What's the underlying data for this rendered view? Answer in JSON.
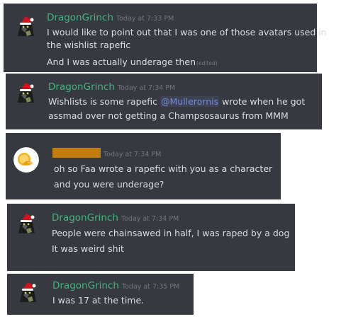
{
  "messages": [
    {
      "author": "DragonGrinch",
      "timestamp": "Today at 7:33 PM",
      "lines": [
        "I would like to point out that I was one of those avatars used in",
        "the wishlist rapefic"
      ],
      "followup": {
        "text": "And I was actually underage then",
        "edited": "(edited)"
      }
    },
    {
      "author": "DragonGrinch",
      "timestamp": "Today at 7:34 PM",
      "line1_before": "Wishlists is some rapefic ",
      "mention": "@Mullerornis",
      "line1_after": " wrote when he got",
      "line2": "assmad over not getting a Champsosaurus from MMM"
    },
    {
      "author_redacted": true,
      "timestamp": "Today at 7:34 PM",
      "lines": [
        "oh so Faa wrote a rapefic with you as a character",
        "and you were underage?"
      ]
    },
    {
      "author": "DragonGrinch",
      "timestamp": "Today at 7:34 PM",
      "lines": [
        "People were chainsawed in half, I was raped by a dog",
        "It was weird shit"
      ]
    },
    {
      "author": "DragonGrinch",
      "timestamp": "Today at 7:35 PM",
      "lines": [
        "I was 17 at the time."
      ]
    }
  ],
  "colors": {
    "background": "#36393f",
    "username": "#43b581",
    "timestamp": "#72767d",
    "text": "#dcddde",
    "mention": "#7289da",
    "redaction": "#c27c0e"
  },
  "icons": {
    "dragon_avatar": "grinch-cat-santa-hat-avatar",
    "orange_avatar": "orange-slice-avatar"
  }
}
